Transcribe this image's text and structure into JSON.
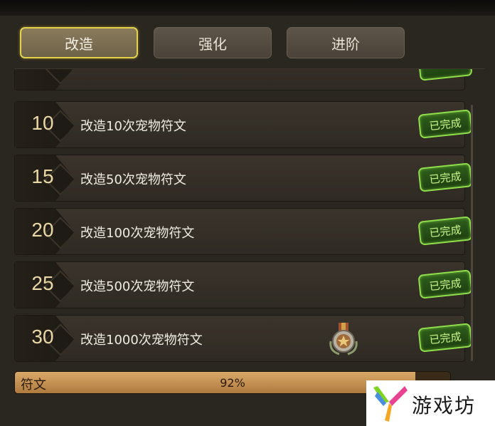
{
  "tabs": [
    {
      "label": "改造",
      "active": true
    },
    {
      "label": "强化",
      "active": false
    },
    {
      "label": "进阶",
      "active": false
    }
  ],
  "rows": [
    {
      "level": "10",
      "desc": "改造10次宠物符文",
      "status": "已完成",
      "reward": null
    },
    {
      "level": "15",
      "desc": "改造50次宠物符文",
      "status": "已完成",
      "reward": null
    },
    {
      "level": "20",
      "desc": "改造100次宠物符文",
      "status": "已完成",
      "reward": null
    },
    {
      "level": "25",
      "desc": "改造500次宠物符文",
      "status": "已完成",
      "reward": null
    },
    {
      "level": "30",
      "desc": "改造1000次宠物符文",
      "status": "已完成",
      "reward": "medal-icon"
    }
  ],
  "progress": {
    "label": "符文",
    "percent_text": "92%",
    "value": 0.92
  },
  "watermark": {
    "text": "游戏坊"
  },
  "colors": {
    "active_tab_border": "#e6d24a",
    "done_badge": "#8fe04a",
    "progress_fill": "#d9a969"
  }
}
